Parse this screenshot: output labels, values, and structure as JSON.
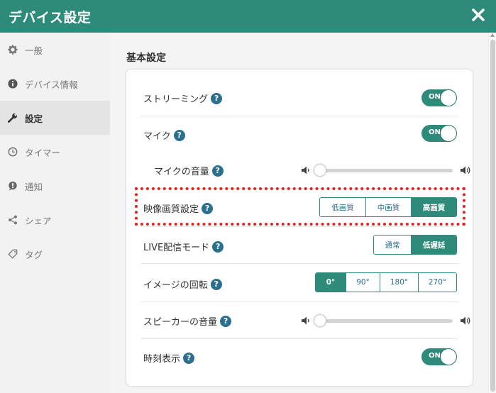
{
  "window": {
    "title": "デバイス設定"
  },
  "sidebar": {
    "items": [
      {
        "label": "一般",
        "icon": "gear-icon"
      },
      {
        "label": "デバイス情報",
        "icon": "info-icon"
      },
      {
        "label": "設定",
        "icon": "wrench-icon",
        "active": true
      },
      {
        "label": "タイマー",
        "icon": "clock-icon"
      },
      {
        "label": "通知",
        "icon": "notification-icon"
      },
      {
        "label": "シェア",
        "icon": "share-icon"
      },
      {
        "label": "タグ",
        "icon": "tag-icon"
      }
    ]
  },
  "main": {
    "section_title": "基本設定",
    "help_symbol": "?",
    "toggle_on_text": "ON",
    "settings": {
      "streaming": {
        "label": "ストリーミング",
        "value": "ON"
      },
      "mic": {
        "label": "マイク",
        "value": "ON"
      },
      "mic_volume": {
        "label": "マイクの音量",
        "level": 0
      },
      "video_quality": {
        "label": "映像画質設定",
        "options": [
          "低画質",
          "中画質",
          "高画質"
        ],
        "selected": "高画質"
      },
      "live_mode": {
        "label": "LIVE配信モード",
        "options": [
          "通常",
          "低遅延"
        ],
        "selected": "低遅延"
      },
      "rotation": {
        "label": "イメージの回転",
        "options": [
          "0°",
          "90°",
          "180°",
          "270°"
        ],
        "selected": "0°"
      },
      "speaker_volume": {
        "label": "スピーカーの音量",
        "level": 0
      },
      "clock_display": {
        "label": "時刻表示",
        "value": "ON"
      }
    }
  },
  "colors": {
    "accent": "#2e8b79",
    "help_icon": "#2a6f8e",
    "highlight": "#e32222"
  }
}
